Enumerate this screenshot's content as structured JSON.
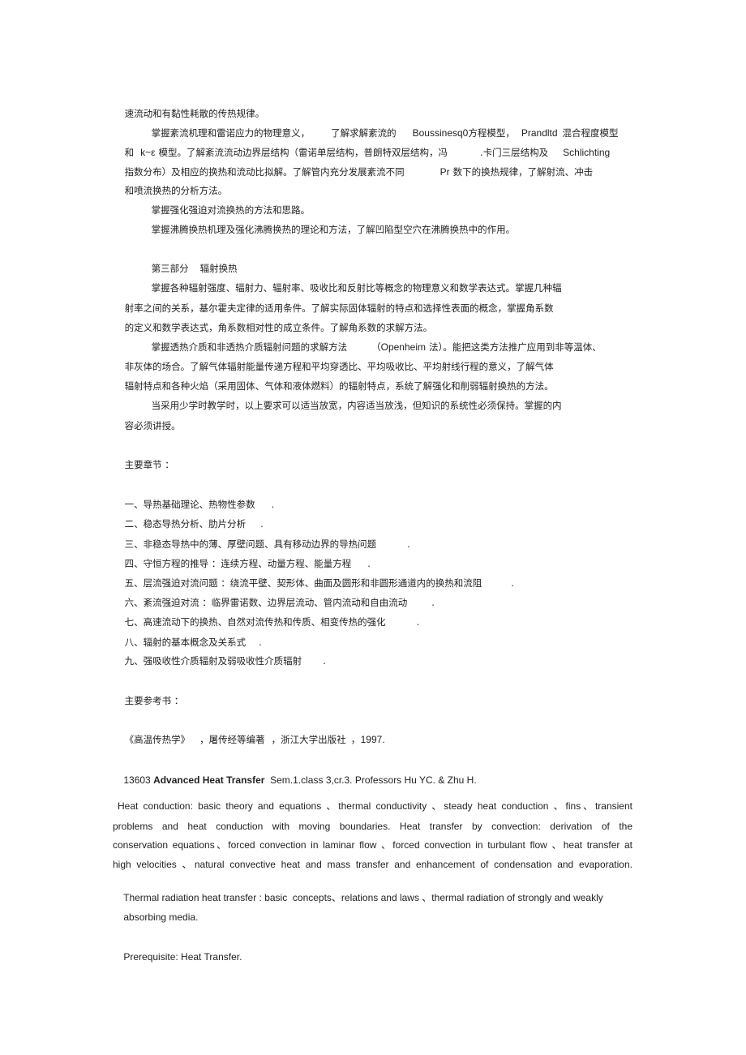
{
  "document": {
    "section2_tail": {
      "line1": "速流动和有黏性耗散的传热规律。"
    },
    "turbulence_paragraph": {
      "line1_a": "掌握紊流机理和雷诺应力的物理意义，",
      "line1_b": "了解求解紊流的",
      "line1_c": "Boussinesq0",
      "line1_d": "方程模型，",
      "line1_e": "Prandltd",
      "line1_f": "混合程度模型",
      "line2_a": "和",
      "line2_b": "k~ε",
      "line2_c": "模型。了解紊流流动边界层结构（雷诺单层结构，普朗特双层结构，冯",
      "line2_d": ".卡门三层结构及",
      "line2_e": "Schlichting",
      "line3_a": "指数分布）及相应的换热和流动比拟解。了解管内充分发展紊流不同",
      "line3_b": "Pr",
      "line3_c": "数下的换热规律，了解射流、冲击",
      "line4": "和喷流换热的分析方法。"
    },
    "forced_convection": "掌握强化强迫对流换热的方法和思路。",
    "boiling": "掌握沸腾换热机理及强化沸腾换热的理论和方法，了解凹陷型空穴在沸腾换热中的作用。",
    "part3_heading": {
      "label": "第三部分",
      "title": "辐射换热"
    },
    "radiation_paragraph": {
      "line1": "掌握各种辐射强度、辐射力、辐射率、吸收比和反射比等概念的物理意义和数学表达式。掌握几种辐",
      "line2": "射率之间的关系，基尔霍夫定律的适用条件。了解实际固体辐射的特点和选择性表面的概念，掌握角系数",
      "line3": "的定义和数学表达式，角系数相对性的成立条件。了解角系数的求解方法。"
    },
    "media_paragraph": {
      "line1_a": "掌握透热介质和非透热介质辐射问题的求解方法",
      "line1_b": "（",
      "line1_c": "Openheim",
      "line1_d": "法）。能把这类方法推广应用到非等温体、",
      "line2": "非灰体的场合。了解气体辐射能量传递方程和平均穿透比、平均吸收比、平均射线行程的意义，了解气体",
      "line3": "辐射特点和各种火焰（采用固体、气体和液体燃料）的辐射特点，系统了解强化和削弱辐射换热的方法。"
    },
    "teaching_note": {
      "line1": "当采用少学时教学时，以上要求可以适当放宽，内容适当放浅，但知识的系统性必须保持。掌握的内",
      "line2": "容必须讲授。"
    },
    "chapters": {
      "heading": "主要章节 ：",
      "items": [
        {
          "text": "一、导热基础理论、热物性参数",
          "end": "."
        },
        {
          "text": "二、稳态导热分析、肋片分析",
          "end": "."
        },
        {
          "text": "三、非稳态导热中的薄、厚壁问题、具有移动边界的导热问题",
          "end": "."
        },
        {
          "text": "四、守恒方程的推导 ：连续方程、动量方程、能量方程",
          "end": "."
        },
        {
          "text": "五、层流强迫对流问题 ：绕流平壁、契形体、曲面及圆形和非圆形通道内的换热和流阻",
          "end": "."
        },
        {
          "text": "六、紊流强迫对流 ：临界雷诺数、边界层流动、管内流动和自由流动",
          "end": "."
        },
        {
          "text": "七、高速流动下的换热、自然对流传热和传质、相变传热的强化",
          "end": "."
        },
        {
          "text": "八、辐射的基本概念及关系式",
          "end": "."
        },
        {
          "text": "九、强吸收性介质辐射及弱吸收性介质辐射",
          "end": "."
        }
      ]
    },
    "references": {
      "heading": "主要参考书 ：",
      "book": {
        "title": "《高温传热学》",
        "author": "，屠传经等编著",
        "publisher": "，浙江大学出版社",
        "year": "，1997."
      }
    },
    "english_course": {
      "code": "13603",
      "title": "Advanced Heat Transfer",
      "details": "Sem.1.class 3,cr.3. Professors Hu YC. & Zhu H.",
      "description_lines": [
        "Heat conduction: basic theory and equations 、thermal conductivity 、steady heat conduction 、fins、transient",
        "problems and heat conduction with moving boundaries. Heat transfer by convection: derivation of the",
        "conservation equations、forced convection in laminar flow 、forced convection in turbulant flow 、heat transfer at",
        "high velocities 、natural convective heat and mass transfer and enhancement of condensation and evaporation.",
        "Thermal radiation heat transfer : basic  concepts、relations and laws 、thermal radiation of strongly and weakly",
        "absorbing media."
      ],
      "prerequisite": "Prerequisite: Heat Transfer."
    }
  }
}
